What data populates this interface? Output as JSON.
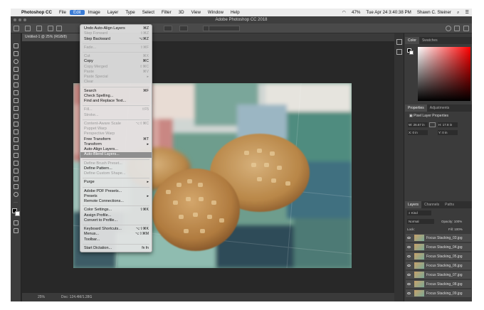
{
  "menubar": {
    "apple": "",
    "app_name": "Photoshop CC",
    "items": [
      "File",
      "Edit",
      "Image",
      "Layer",
      "Type",
      "Select",
      "Filter",
      "3D",
      "View",
      "Window",
      "Help"
    ],
    "battery": "47%",
    "datetime": "Tue Apr 24  3:40:38 PM",
    "user": "Shawn C. Steiner"
  },
  "window": {
    "title": "Adobe Photoshop CC 2018"
  },
  "document": {
    "tab": "Untitled-1 @ 25% (RGB/8)",
    "zoom": "25%",
    "doc_info": "Doc: 124.4M/1.28G"
  },
  "edit_menu": [
    {
      "label": "Undo Auto-Align Layers",
      "shortcut": "⌘Z",
      "enabled": true
    },
    {
      "label": "Step Forward",
      "shortcut": "⇧⌘Z",
      "enabled": false
    },
    {
      "label": "Step Backward",
      "shortcut": "⌥⌘Z",
      "enabled": true
    },
    {
      "sep": true
    },
    {
      "label": "Fade...",
      "shortcut": "⇧⌘F",
      "enabled": false
    },
    {
      "sep": true
    },
    {
      "label": "Cut",
      "shortcut": "⌘X",
      "enabled": false
    },
    {
      "label": "Copy",
      "shortcut": "⌘C",
      "enabled": true
    },
    {
      "label": "Copy Merged",
      "shortcut": "⇧⌘C",
      "enabled": false
    },
    {
      "label": "Paste",
      "shortcut": "⌘V",
      "enabled": false
    },
    {
      "label": "Paste Special",
      "shortcut": "▸",
      "enabled": false
    },
    {
      "label": "Clear",
      "shortcut": "",
      "enabled": false
    },
    {
      "sep": true
    },
    {
      "label": "Search",
      "shortcut": "⌘F",
      "enabled": true
    },
    {
      "label": "Check Spelling...",
      "shortcut": "",
      "enabled": true
    },
    {
      "label": "Find and Replace Text...",
      "shortcut": "",
      "enabled": true
    },
    {
      "sep": true
    },
    {
      "label": "Fill...",
      "shortcut": "⇧F5",
      "enabled": false
    },
    {
      "label": "Stroke...",
      "shortcut": "",
      "enabled": false
    },
    {
      "sep": true
    },
    {
      "label": "Content-Aware Scale",
      "shortcut": "⌥⇧⌘C",
      "enabled": false
    },
    {
      "label": "Puppet Warp",
      "shortcut": "",
      "enabled": false
    },
    {
      "label": "Perspective Warp",
      "shortcut": "",
      "enabled": false
    },
    {
      "label": "Free Transform",
      "shortcut": "⌘T",
      "enabled": true
    },
    {
      "label": "Transform",
      "shortcut": "▸",
      "enabled": true
    },
    {
      "label": "Auto-Align Layers...",
      "shortcut": "",
      "enabled": true
    },
    {
      "label": "Auto-Blend Layers...",
      "shortcut": "",
      "enabled": true,
      "highlighted": true
    },
    {
      "sep": true
    },
    {
      "label": "Define Brush Preset...",
      "shortcut": "",
      "enabled": false
    },
    {
      "label": "Define Pattern...",
      "shortcut": "",
      "enabled": true
    },
    {
      "label": "Define Custom Shape...",
      "shortcut": "",
      "enabled": false
    },
    {
      "sep": true
    },
    {
      "label": "Purge",
      "shortcut": "▸",
      "enabled": true
    },
    {
      "sep": true
    },
    {
      "label": "Adobe PDF Presets...",
      "shortcut": "",
      "enabled": true
    },
    {
      "label": "Presets",
      "shortcut": "▸",
      "enabled": true
    },
    {
      "label": "Remote Connections...",
      "shortcut": "",
      "enabled": true
    },
    {
      "sep": true
    },
    {
      "label": "Color Settings...",
      "shortcut": "⇧⌘K",
      "enabled": true
    },
    {
      "label": "Assign Profile...",
      "shortcut": "",
      "enabled": true
    },
    {
      "label": "Convert to Profile...",
      "shortcut": "",
      "enabled": true
    },
    {
      "sep": true
    },
    {
      "label": "Keyboard Shortcuts...",
      "shortcut": "⌥⇧⌘K",
      "enabled": true
    },
    {
      "label": "Menus...",
      "shortcut": "⌥⇧⌘M",
      "enabled": true
    },
    {
      "label": "Toolbar...",
      "shortcut": "",
      "enabled": true
    },
    {
      "sep": true
    },
    {
      "label": "Start Dictation...",
      "shortcut": "fn fn",
      "enabled": true
    }
  ],
  "color_panel": {
    "tabs": [
      "Color",
      "Swatches"
    ]
  },
  "properties_panel": {
    "tabs": [
      "Properties",
      "Adjustments"
    ],
    "title": "Pixel Layer Properties",
    "w": "W: 26.67 in",
    "h": "H: 17.8 in",
    "x": "X: 0 in",
    "y": "Y: 0 in"
  },
  "layers_panel": {
    "tabs": [
      "Layers",
      "Channels",
      "Paths"
    ],
    "kind": "Kind",
    "mode": "Normal",
    "opacity_label": "Opacity:",
    "opacity": "100%",
    "lock_label": "Lock:",
    "fill_label": "Fill:",
    "fill": "100%",
    "layers": [
      "Focus Stacking_03.jpg",
      "Focus Stacking_04.jpg",
      "Focus Stacking_05.jpg",
      "Focus Stacking_06.jpg",
      "Focus Stacking_07.jpg",
      "Focus Stacking_08.jpg",
      "Focus Stacking_09.jpg"
    ]
  },
  "colors": {
    "accent": "#3a7bd5",
    "menu_highlight": "#8e8e8e",
    "panel_bg": "#3b3b3b"
  }
}
